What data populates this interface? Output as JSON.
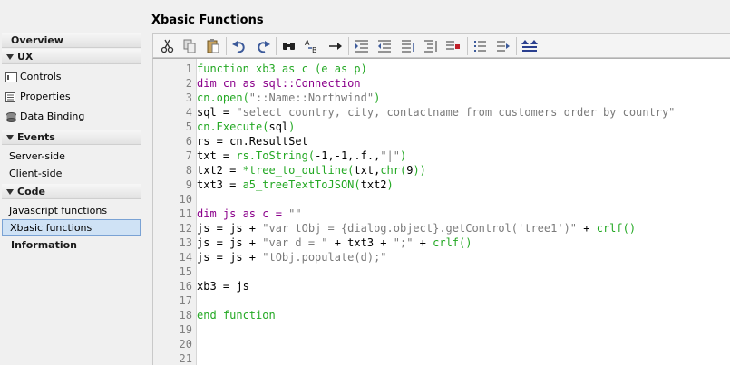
{
  "sidebar": {
    "overview": "Overview",
    "ux": "UX",
    "ux_items": [
      "Controls",
      "Properties",
      "Data Binding"
    ],
    "events": "Events",
    "event_items": [
      "Server-side",
      "Client-side"
    ],
    "code": "Code",
    "code_items": [
      "Javascript functions",
      "Xbasic functions"
    ],
    "information": "Information",
    "selected": "Xbasic functions"
  },
  "main": {
    "title": "Xbasic Functions"
  },
  "toolbar": {
    "icons": [
      "cut-icon",
      "copy-icon",
      "paste-icon",
      "undo-icon",
      "redo-icon",
      "find-icon",
      "replace-icon",
      "goto-icon",
      "indent-icon",
      "outdent-icon",
      "comment-icon",
      "uncomment-icon",
      "bookmark-icon",
      "bullet-list-icon",
      "numbered-list-icon",
      "expand-icon"
    ]
  },
  "editor": {
    "line_numbers": [
      "1",
      "2",
      "3",
      "4",
      "5",
      "6",
      "7",
      "8",
      "9",
      "10",
      "11",
      "12",
      "13",
      "14",
      "15",
      "16",
      "17",
      "18",
      "19",
      "20",
      "21"
    ],
    "lines": [
      [
        {
          "t": "function xb3 as c (e as p)",
          "c": "g"
        }
      ],
      [
        {
          "t": "dim cn as sql::Connection",
          "c": "k"
        }
      ],
      [
        {
          "t": "cn.open(",
          "c": "g"
        },
        {
          "t": "\"::Name::Northwind\"",
          "c": "s"
        },
        {
          "t": ")",
          "c": "g"
        }
      ],
      [
        {
          "t": "sql = ",
          "c": "b"
        },
        {
          "t": "\"select country, city, contactname from customers order by country\"",
          "c": "s"
        }
      ],
      [
        {
          "t": "cn.Execute(",
          "c": "g"
        },
        {
          "t": "sql",
          "c": "b"
        },
        {
          "t": ")",
          "c": "g"
        }
      ],
      [
        {
          "t": "rs = cn.ResultSet",
          "c": "b"
        }
      ],
      [
        {
          "t": "txt = ",
          "c": "b"
        },
        {
          "t": "rs.ToString(",
          "c": "g"
        },
        {
          "t": "-1,-1,.f.,",
          "c": "b"
        },
        {
          "t": "\"|\"",
          "c": "s"
        },
        {
          "t": ")",
          "c": "g"
        }
      ],
      [
        {
          "t": "txt2 = ",
          "c": "b"
        },
        {
          "t": "*tree_to_outline(",
          "c": "g"
        },
        {
          "t": "txt,",
          "c": "b"
        },
        {
          "t": "chr(",
          "c": "g"
        },
        {
          "t": "9",
          "c": "b"
        },
        {
          "t": "))",
          "c": "g"
        }
      ],
      [
        {
          "t": "txt3 = ",
          "c": "b"
        },
        {
          "t": "a5_treeTextToJSON(",
          "c": "g"
        },
        {
          "t": "txt2",
          "c": "b"
        },
        {
          "t": ")",
          "c": "g"
        }
      ],
      [],
      [
        {
          "t": "dim js as c = ",
          "c": "k"
        },
        {
          "t": "\"\"",
          "c": "s"
        }
      ],
      [
        {
          "t": "js = js + ",
          "c": "b"
        },
        {
          "t": "\"var tObj = {dialog.object}.getControl('tree1')\"",
          "c": "s"
        },
        {
          "t": " + ",
          "c": "b"
        },
        {
          "t": "crlf()",
          "c": "g"
        }
      ],
      [
        {
          "t": "js = js + ",
          "c": "b"
        },
        {
          "t": "\"var d = \"",
          "c": "s"
        },
        {
          "t": " + txt3 + ",
          "c": "b"
        },
        {
          "t": "\";\"",
          "c": "s"
        },
        {
          "t": " + ",
          "c": "b"
        },
        {
          "t": "crlf()",
          "c": "g"
        }
      ],
      [
        {
          "t": "js = js + ",
          "c": "b"
        },
        {
          "t": "\"tObj.populate(d);\"",
          "c": "s"
        }
      ],
      [],
      [
        {
          "t": "xb3 = js",
          "c": "b"
        }
      ],
      [],
      [
        {
          "t": "end function",
          "c": "g"
        }
      ],
      [],
      [],
      []
    ]
  },
  "colors": {
    "keyword_green": "#23a823",
    "string_gray": "#7a7a7a",
    "dim_purple": "#8b008b",
    "selection": "#cfe2f5"
  }
}
